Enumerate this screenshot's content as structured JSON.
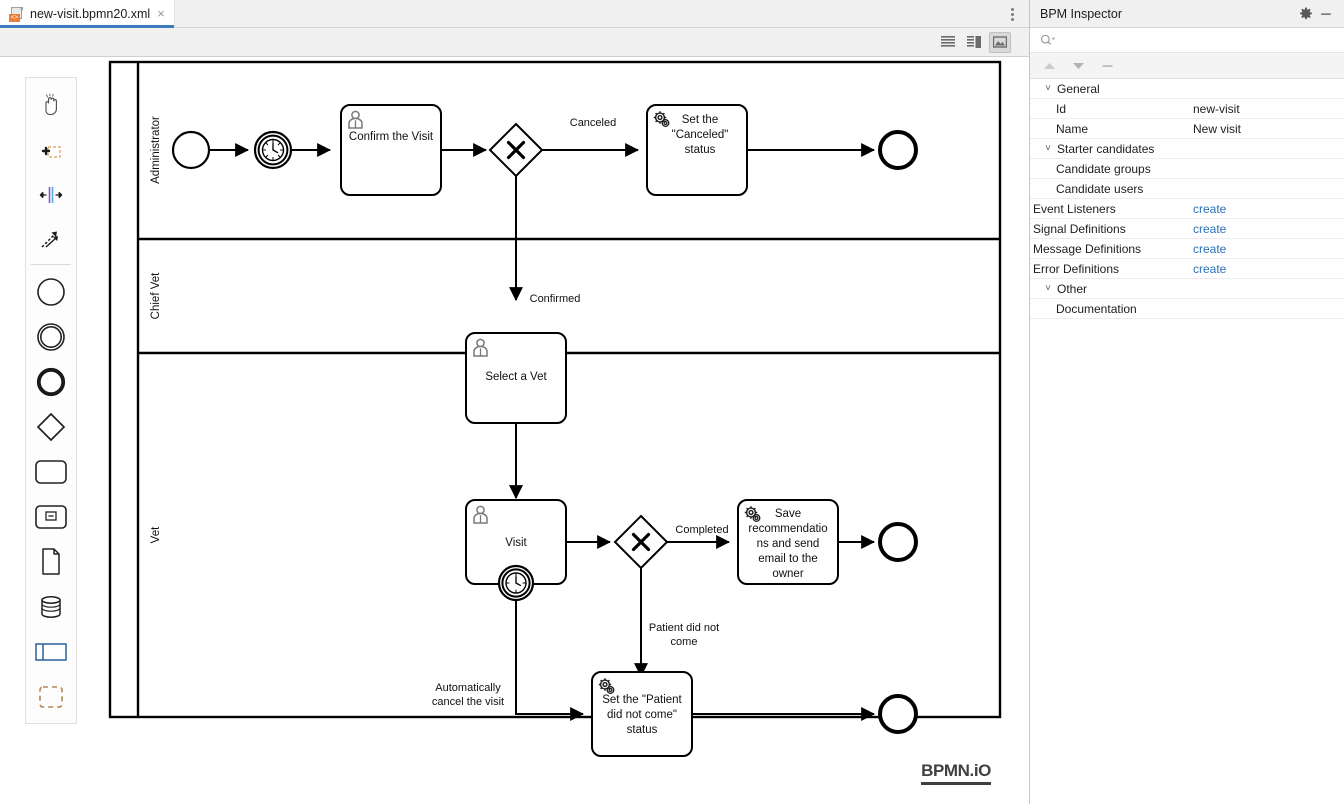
{
  "window": {
    "tab": {
      "title": "new-visit.bpmn20.xml",
      "close_label": "×",
      "icon": "xml-file-icon",
      "badge": "<>"
    },
    "kebab_icon": "more-vertical-icon"
  },
  "editor_toolbar": {
    "buttons": [
      {
        "name": "source-view",
        "icon": "text-lines-icon",
        "selected": false
      },
      {
        "name": "split-view",
        "icon": "split-pane-icon",
        "selected": false
      },
      {
        "name": "diagram-view",
        "icon": "image-icon",
        "selected": true
      }
    ]
  },
  "palette": {
    "items": [
      {
        "name": "hand-tool",
        "icon": "hand-icon"
      },
      {
        "name": "lasso-tool",
        "icon": "lasso-select-icon"
      },
      {
        "name": "space-tool",
        "icon": "space-arrows-icon"
      },
      {
        "name": "connect-tool",
        "icon": "connect-arrow-icon"
      },
      {
        "name": "start-event",
        "icon": "start-event-circle-icon"
      },
      {
        "name": "intermediate-event",
        "icon": "intermediate-event-double-circle-icon"
      },
      {
        "name": "end-event",
        "icon": "end-event-thick-circle-icon"
      },
      {
        "name": "gateway",
        "icon": "gateway-diamond-icon"
      },
      {
        "name": "task",
        "icon": "task-rounded-rect-icon"
      },
      {
        "name": "subprocess",
        "icon": "subprocess-collapsed-icon"
      },
      {
        "name": "data-object",
        "icon": "data-object-page-icon"
      },
      {
        "name": "data-store",
        "icon": "data-store-cylinder-icon"
      },
      {
        "name": "participant",
        "icon": "participant-pool-icon"
      },
      {
        "name": "group",
        "icon": "group-dashed-icon"
      }
    ]
  },
  "canvas": {
    "logo": "BPMN.iO",
    "lanes": [
      {
        "id": "administrator",
        "label": "Administrator"
      },
      {
        "id": "chief-vet",
        "label": "Chief Vet"
      },
      {
        "id": "vet",
        "label": "Vet"
      }
    ],
    "nodes": [
      {
        "id": "start",
        "type": "start-event",
        "lane": "administrator",
        "label": ""
      },
      {
        "id": "timer-start",
        "type": "timer-intermediate-event",
        "lane": "administrator",
        "label": ""
      },
      {
        "id": "confirm-visit",
        "type": "user-task",
        "lane": "administrator",
        "label": "Confirm the Visit"
      },
      {
        "id": "confirm-gateway",
        "type": "exclusive-gateway",
        "lane": "administrator",
        "label": ""
      },
      {
        "id": "set-canceled",
        "type": "service-task",
        "lane": "administrator",
        "label": "Set the \"Canceled\" status"
      },
      {
        "id": "end-canceled",
        "type": "end-event",
        "lane": "administrator",
        "label": ""
      },
      {
        "id": "select-vet",
        "type": "user-task",
        "lane": "chief-vet",
        "label": "Select a Vet"
      },
      {
        "id": "visit",
        "type": "user-task",
        "lane": "vet",
        "label": "Visit"
      },
      {
        "id": "visit-timer",
        "type": "boundary-timer-event",
        "lane": "vet",
        "label": ""
      },
      {
        "id": "visit-gateway",
        "type": "exclusive-gateway",
        "lane": "vet",
        "label": ""
      },
      {
        "id": "save-recommendations",
        "type": "service-task",
        "lane": "vet",
        "label": "Save recommendations and send email to the owner"
      },
      {
        "id": "end-completed",
        "type": "end-event",
        "lane": "vet",
        "label": ""
      },
      {
        "id": "set-no-show",
        "type": "service-task",
        "lane": "vet",
        "label": "Set the \"Patient did not come\" status"
      },
      {
        "id": "end-no-show",
        "type": "end-event",
        "lane": "vet",
        "label": ""
      }
    ],
    "flow_labels": {
      "canceled": "Canceled",
      "confirmed": "Confirmed",
      "completed": "Completed",
      "patient_did_not_come_line1": "Patient did not",
      "patient_did_not_come_line2": "come",
      "auto_cancel_line1": "Automatically",
      "auto_cancel_line2": "cancel the visit"
    },
    "task_text": {
      "confirm_visit": "Confirm the Visit",
      "set_canceled_l1": "Set the",
      "set_canceled_l2": "\"Canceled\"",
      "set_canceled_l3": "status",
      "select_vet": "Select a Vet",
      "visit": "Visit",
      "save_rec_l1": "Save",
      "save_rec_l2": "recommendatio",
      "save_rec_l3": "ns and send",
      "save_rec_l4": "email to the",
      "save_rec_l5": "owner",
      "set_noshow_l1": "Set the \"Patient",
      "set_noshow_l2": "did not come\"",
      "set_noshow_l3": "status"
    }
  },
  "inspector": {
    "title": "BPM Inspector",
    "settings_icon": "gear-icon",
    "minimize_icon": "minimize-icon",
    "search": {
      "placeholder": "",
      "value": "",
      "icon": "search-icon"
    },
    "toolbar": [
      {
        "name": "expand-up",
        "icon": "triangle-up-icon"
      },
      {
        "name": "collapse-down",
        "icon": "triangle-down-icon"
      },
      {
        "name": "collapse-all",
        "icon": "minus-icon"
      }
    ],
    "rows": [
      {
        "kind": "group",
        "twisty": "˅",
        "name": "General",
        "value": ""
      },
      {
        "kind": "child",
        "name": "Id",
        "value": "new-visit"
      },
      {
        "kind": "child",
        "name": "Name",
        "value": "New visit"
      },
      {
        "kind": "group",
        "twisty": "˅",
        "name": "Starter candidates",
        "value": ""
      },
      {
        "kind": "child",
        "name": "Candidate groups",
        "value": ""
      },
      {
        "kind": "child",
        "name": "Candidate users",
        "value": ""
      },
      {
        "kind": "flush",
        "name": "Event Listeners",
        "value": "create",
        "link": true
      },
      {
        "kind": "flush",
        "name": "Signal Definitions",
        "value": "create",
        "link": true
      },
      {
        "kind": "flush",
        "name": "Message Definitions",
        "value": "create",
        "link": true
      },
      {
        "kind": "flush",
        "name": "Error Definitions",
        "value": "create",
        "link": true
      },
      {
        "kind": "group",
        "twisty": "˅",
        "name": "Other",
        "value": ""
      },
      {
        "kind": "child",
        "name": "Documentation",
        "value": ""
      }
    ]
  },
  "colors": {
    "accent": "#3c7cbe",
    "link": "#2f6fb8",
    "toolbar_bg": "#f0f0f0",
    "selected_btn": "#d9d9d9",
    "stroke": "#000000"
  }
}
